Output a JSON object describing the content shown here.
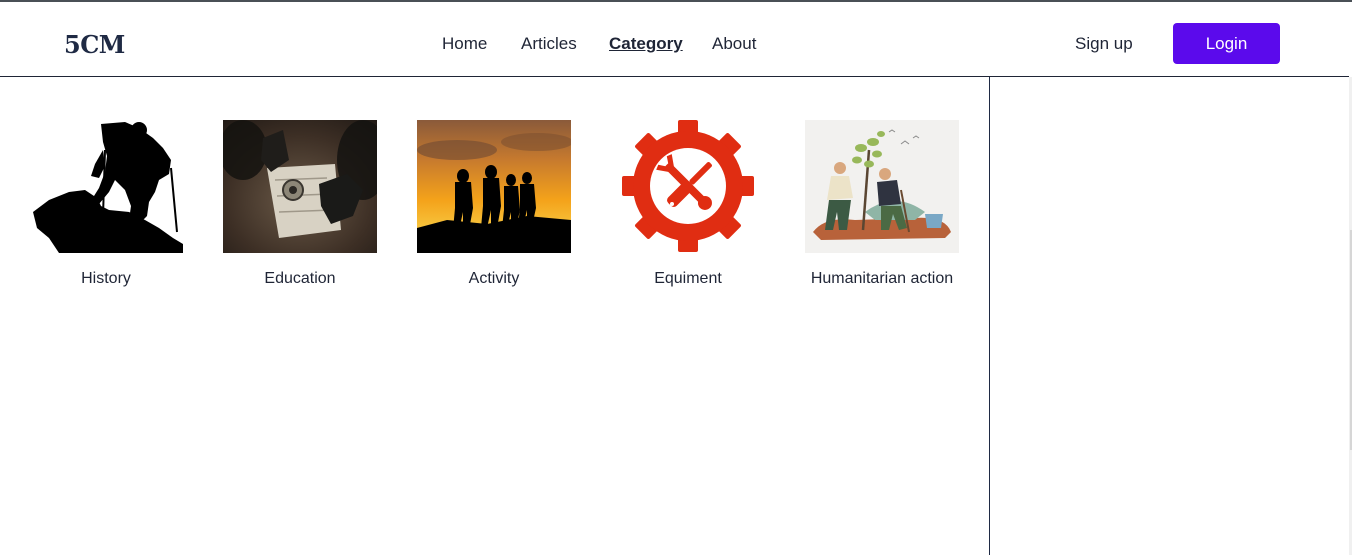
{
  "header": {
    "logo": "5CM",
    "nav": [
      {
        "label": "Home",
        "active": false
      },
      {
        "label": "Articles",
        "active": false
      },
      {
        "label": "Category",
        "active": true
      },
      {
        "label": "About",
        "active": false
      }
    ],
    "signup_label": "Sign up",
    "login_label": "Login"
  },
  "categories": [
    {
      "label": "History",
      "image": "hiker-silhouette"
    },
    {
      "label": "Education",
      "image": "compass-map"
    },
    {
      "label": "Activity",
      "image": "sunset-hikers"
    },
    {
      "label": "Equiment",
      "image": "gear-tools-icon"
    },
    {
      "label": "Humanitarian action",
      "image": "tree-planting"
    }
  ],
  "colors": {
    "accent": "#5b0aec",
    "text": "#1f2536",
    "equipment_red": "#e02d12"
  }
}
